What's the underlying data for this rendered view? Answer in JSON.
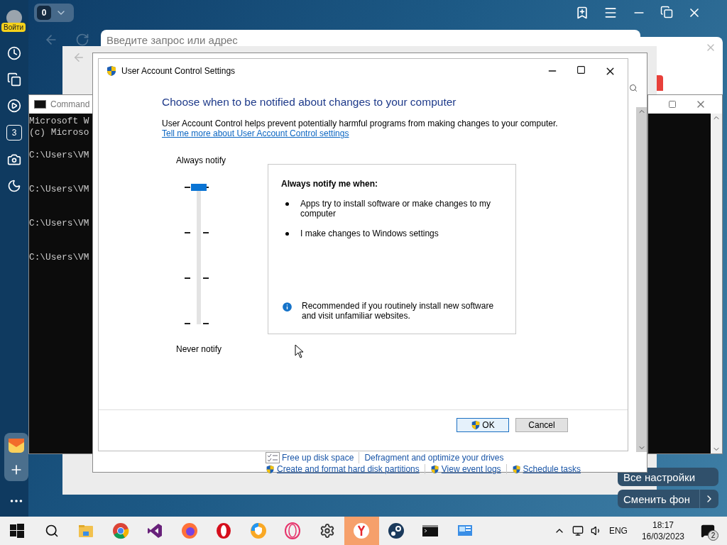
{
  "browser": {
    "profile_badge": "Войти",
    "tab_count": "0",
    "address_placeholder": "Введите запрос или адрес",
    "sidebar_badge": "3",
    "widgets": [
      "Все настройки",
      "Сменить фон"
    ]
  },
  "command_prompt": {
    "title": "Command ",
    "header": [
      "Microsoft W",
      "(c) Microso"
    ],
    "prompts": [
      "C:\\Users\\VM",
      "C:\\Users\\VM",
      "C:\\Users\\VM",
      "C:\\Users\\VM"
    ]
  },
  "uac": {
    "title": "User Account Control Settings",
    "heading": "Choose when to be notified about changes to your computer",
    "description": "User Account Control helps prevent potentially harmful programs from making changes to your computer.",
    "link": "Tell me more about User Account Control settings",
    "slider": {
      "top_label": "Always notify",
      "bottom_label": "Never notify",
      "level": 1
    },
    "panel": {
      "heading": "Always notify me when:",
      "bullets": [
        "Apps try to install software or make changes to my computer",
        "I make changes to Windows settings"
      ],
      "note": "Recommended if you routinely install new software and visit unfamiliar websites."
    },
    "buttons": [
      {
        "label": "OK",
        "shield": true,
        "default": true
      },
      {
        "label": "Cancel",
        "shield": false,
        "default": false
      }
    ]
  },
  "control_panel_links": [
    [
      {
        "label": "Free up disk space",
        "kind": "checklist"
      },
      {
        "label": "Defragment and optimize your drives",
        "kind": "plain"
      }
    ],
    [
      {
        "label": "Create and format hard disk partitions",
        "kind": "shield"
      },
      {
        "label": "View event logs",
        "kind": "shield"
      },
      {
        "label": "Schedule tasks",
        "kind": "shield"
      }
    ]
  ],
  "taskbar": {
    "apps": [
      {
        "kind": "start",
        "selected": false
      },
      {
        "kind": "search",
        "selected": false
      },
      {
        "kind": "folder",
        "selected": false
      },
      {
        "kind": "tricolor",
        "selected": false
      },
      {
        "kind": "ribbon",
        "selected": false
      },
      {
        "kind": "fox",
        "selected": false
      },
      {
        "kind": "redring",
        "selected": false
      },
      {
        "kind": "shieldbrowser",
        "selected": false
      },
      {
        "kind": "pinkring",
        "selected": false
      },
      {
        "kind": "gear",
        "selected": false
      },
      {
        "kind": "yring",
        "selected": true
      },
      {
        "kind": "steam",
        "selected": false
      },
      {
        "kind": "terminal",
        "selected": false
      },
      {
        "kind": "panel",
        "selected": false
      }
    ],
    "language": "ENG",
    "time": "18:17",
    "date": "16/03/2023",
    "notifications": "2"
  }
}
